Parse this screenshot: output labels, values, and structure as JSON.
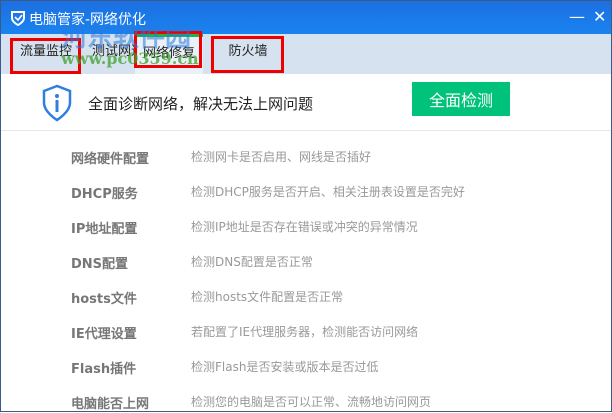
{
  "window": {
    "title": "电脑管家-网络优化",
    "minimize": "—",
    "close": "✕"
  },
  "tabs": [
    {
      "label": "流量监控"
    },
    {
      "label": "测试网速"
    },
    {
      "label": "网络修复",
      "active": true
    },
    {
      "label": "防火墙"
    }
  ],
  "header": {
    "message": "全面诊断网络，解决无法上网问题",
    "scan_button": "全面检测"
  },
  "items": [
    {
      "name": "网络硬件配置",
      "desc": "检测网卡是否启用、网线是否插好"
    },
    {
      "name": "DHCP服务",
      "desc": "检测DHCP服务是否开启、相关注册表设置是否完好"
    },
    {
      "name": "IP地址配置",
      "desc": "检测IP地址是否存在错误或冲突的异常情况"
    },
    {
      "name": "DNS配置",
      "desc": "检测DNS配置是否正常"
    },
    {
      "name": "hosts文件",
      "desc": "检测hosts文件配置是否正常"
    },
    {
      "name": "IE代理设置",
      "desc": "若配置了IE代理服务器，检测能否访问网络"
    },
    {
      "name": "Flash插件",
      "desc": "检测Flash是否安装或版本是否过低"
    },
    {
      "name": "电脑能否上网",
      "desc": "检测您的电脑是否可以正常、流畅地访问网页"
    }
  ],
  "watermark": {
    "site": "河东软件园",
    "url": "www.pc0359.cn"
  },
  "colors": {
    "accent": "#00c27a",
    "titlebar": "#1a78e8",
    "tab_active_line": "#22b24c",
    "highlight": "#e00000"
  }
}
